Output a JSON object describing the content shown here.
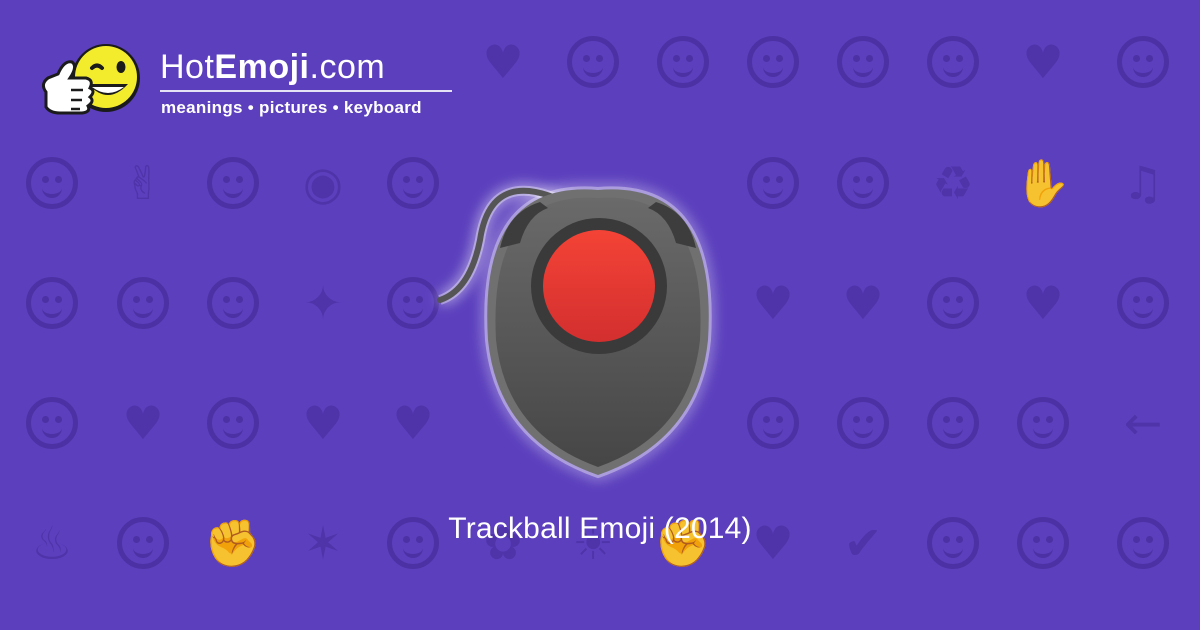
{
  "brand": {
    "name_prefix": "Hot",
    "name_bold": "Emoji",
    "name_suffix": ".com",
    "tagline": "meanings • pictures • keyboard"
  },
  "caption": "Trackball Emoji (2014)",
  "colors": {
    "background": "#5b3fbd",
    "pattern": "#4c31a4",
    "ball": "#e53935",
    "body": "#555555",
    "glow": "#ffffff"
  },
  "background_icons": [
    "heart-icon",
    "smiling-face-icon",
    "face-icon",
    "face-icon",
    "face-icon",
    "winking-kiss-face-icon",
    "two-hearts-icon",
    "smiling-face-icon",
    "tired-face-icon",
    "ok-hand-icon",
    "neutral-face-icon",
    "eyes-icon",
    "smirk-face-icon",
    "relieved-face-icon",
    "scream-face-icon",
    "recycle-icon",
    "raising-hands-icon",
    "music-notes-icon",
    "sleeping-face-icon",
    "sad-face-icon",
    "grinning-face-icon",
    "sparkles-icon",
    "grinning-face-icon",
    "striped-heart-icon",
    "broken-heart-icon",
    "confused-face-icon",
    "striped-heart-icon",
    "tongue-face-icon",
    "frowning-face-icon",
    "heart-arrow-icon",
    "weary-face-icon",
    "revolving-hearts-icon",
    "heart-icon",
    "monkey-icon",
    "screaming-face-icon",
    "smiling-devil-icon",
    "angry-face-icon",
    "left-arrow-icon",
    "fire-icon",
    "grinning-face-icon",
    "fist-icon",
    "party-popper-icon",
    "tongue-face-icon",
    "rose-icon",
    "sun-icon",
    "flexed-biceps-icon",
    "striped-heart-icon",
    "check-mark-icon",
    "laughing-face-icon",
    "moon-face-icon",
    "heart-eyes-cat-icon",
    "waving-hand-icon",
    "mask-face-icon",
    "camera-icon",
    "frowning-face-icon",
    "striped-heart-icon",
    "grinning-face-icon",
    "beating-heart-icon",
    "kissing-face-icon"
  ]
}
